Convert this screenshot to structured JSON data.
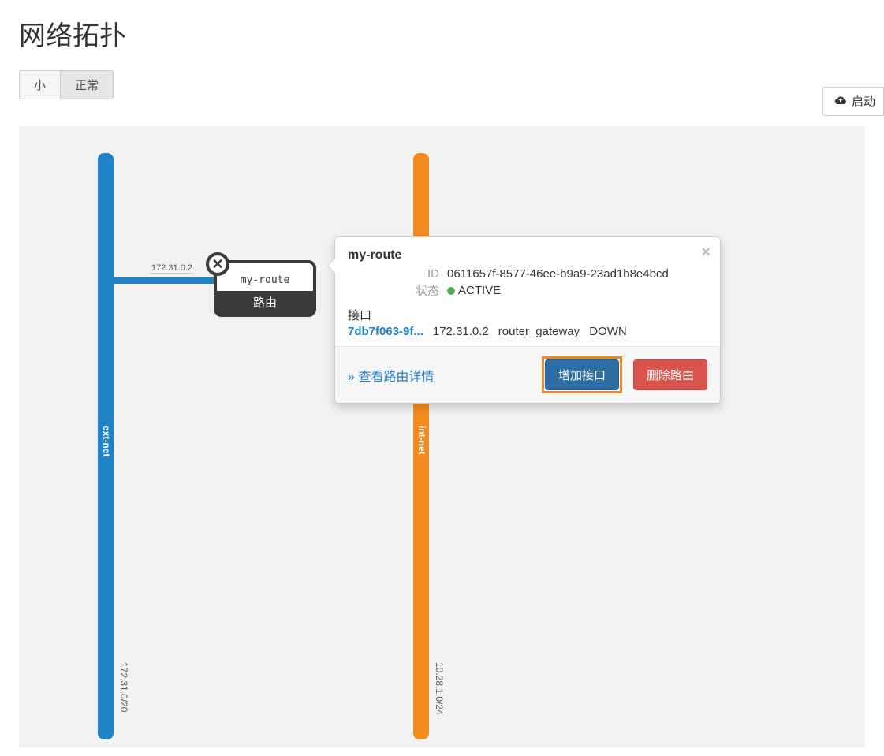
{
  "page": {
    "title": "网络拓扑"
  },
  "toolbar": {
    "size_small": "小",
    "size_normal": "正常",
    "launch": "启动"
  },
  "networks": {
    "ext": {
      "name": "ext-net",
      "cidr": "172.31.0/20",
      "color": "#1f83c6"
    },
    "int": {
      "name": "int-net",
      "cidr": "10.28.1.0/24",
      "color": "#f38c1f"
    }
  },
  "router_node": {
    "name": "my-route",
    "caption": "路由",
    "iface_ip": "172.31.0.2"
  },
  "popover": {
    "title": "my-route",
    "id_label": "ID",
    "id_value": "0611657f-8577-46ee-b9a9-23ad1b8e4bcd",
    "status_label": "状态",
    "status_value": "ACTIVE",
    "section_interfaces": "接口",
    "iface": {
      "id_short": "7db7f063-9f...",
      "ip": "172.31.0.2",
      "type": "router_gateway",
      "state": "DOWN"
    },
    "link_detail": "» 查看路由详情",
    "btn_add_iface": "增加接口",
    "btn_delete_router": "删除路由"
  }
}
